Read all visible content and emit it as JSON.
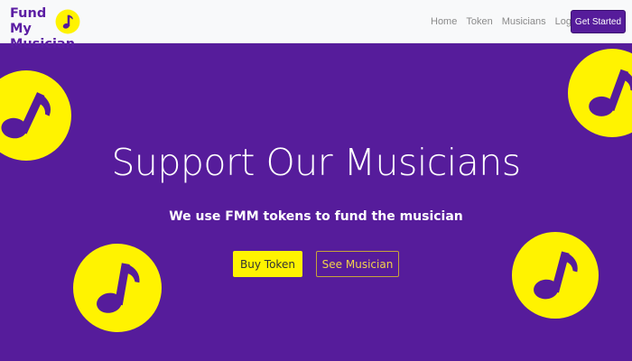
{
  "navbar": {
    "brand_line1": "Fund My",
    "brand_line2": "Musician",
    "logo_icon": "music-note-icon",
    "links": [
      "Home",
      "Token",
      "Musicians",
      "Login"
    ],
    "cta_label": "Get Started"
  },
  "hero": {
    "title": "Support Our Musicians",
    "subtitle": "We use FMM tokens to fund the musician",
    "primary_button": "Buy Token",
    "secondary_button": "See Musician",
    "decor_icon": "music-note-icon"
  },
  "colors": {
    "primary_purple": "#561c9b",
    "accent_yellow": "#fff300",
    "navbar_bg": "#f8f9fa",
    "outline_gold": "#c7a33a"
  }
}
